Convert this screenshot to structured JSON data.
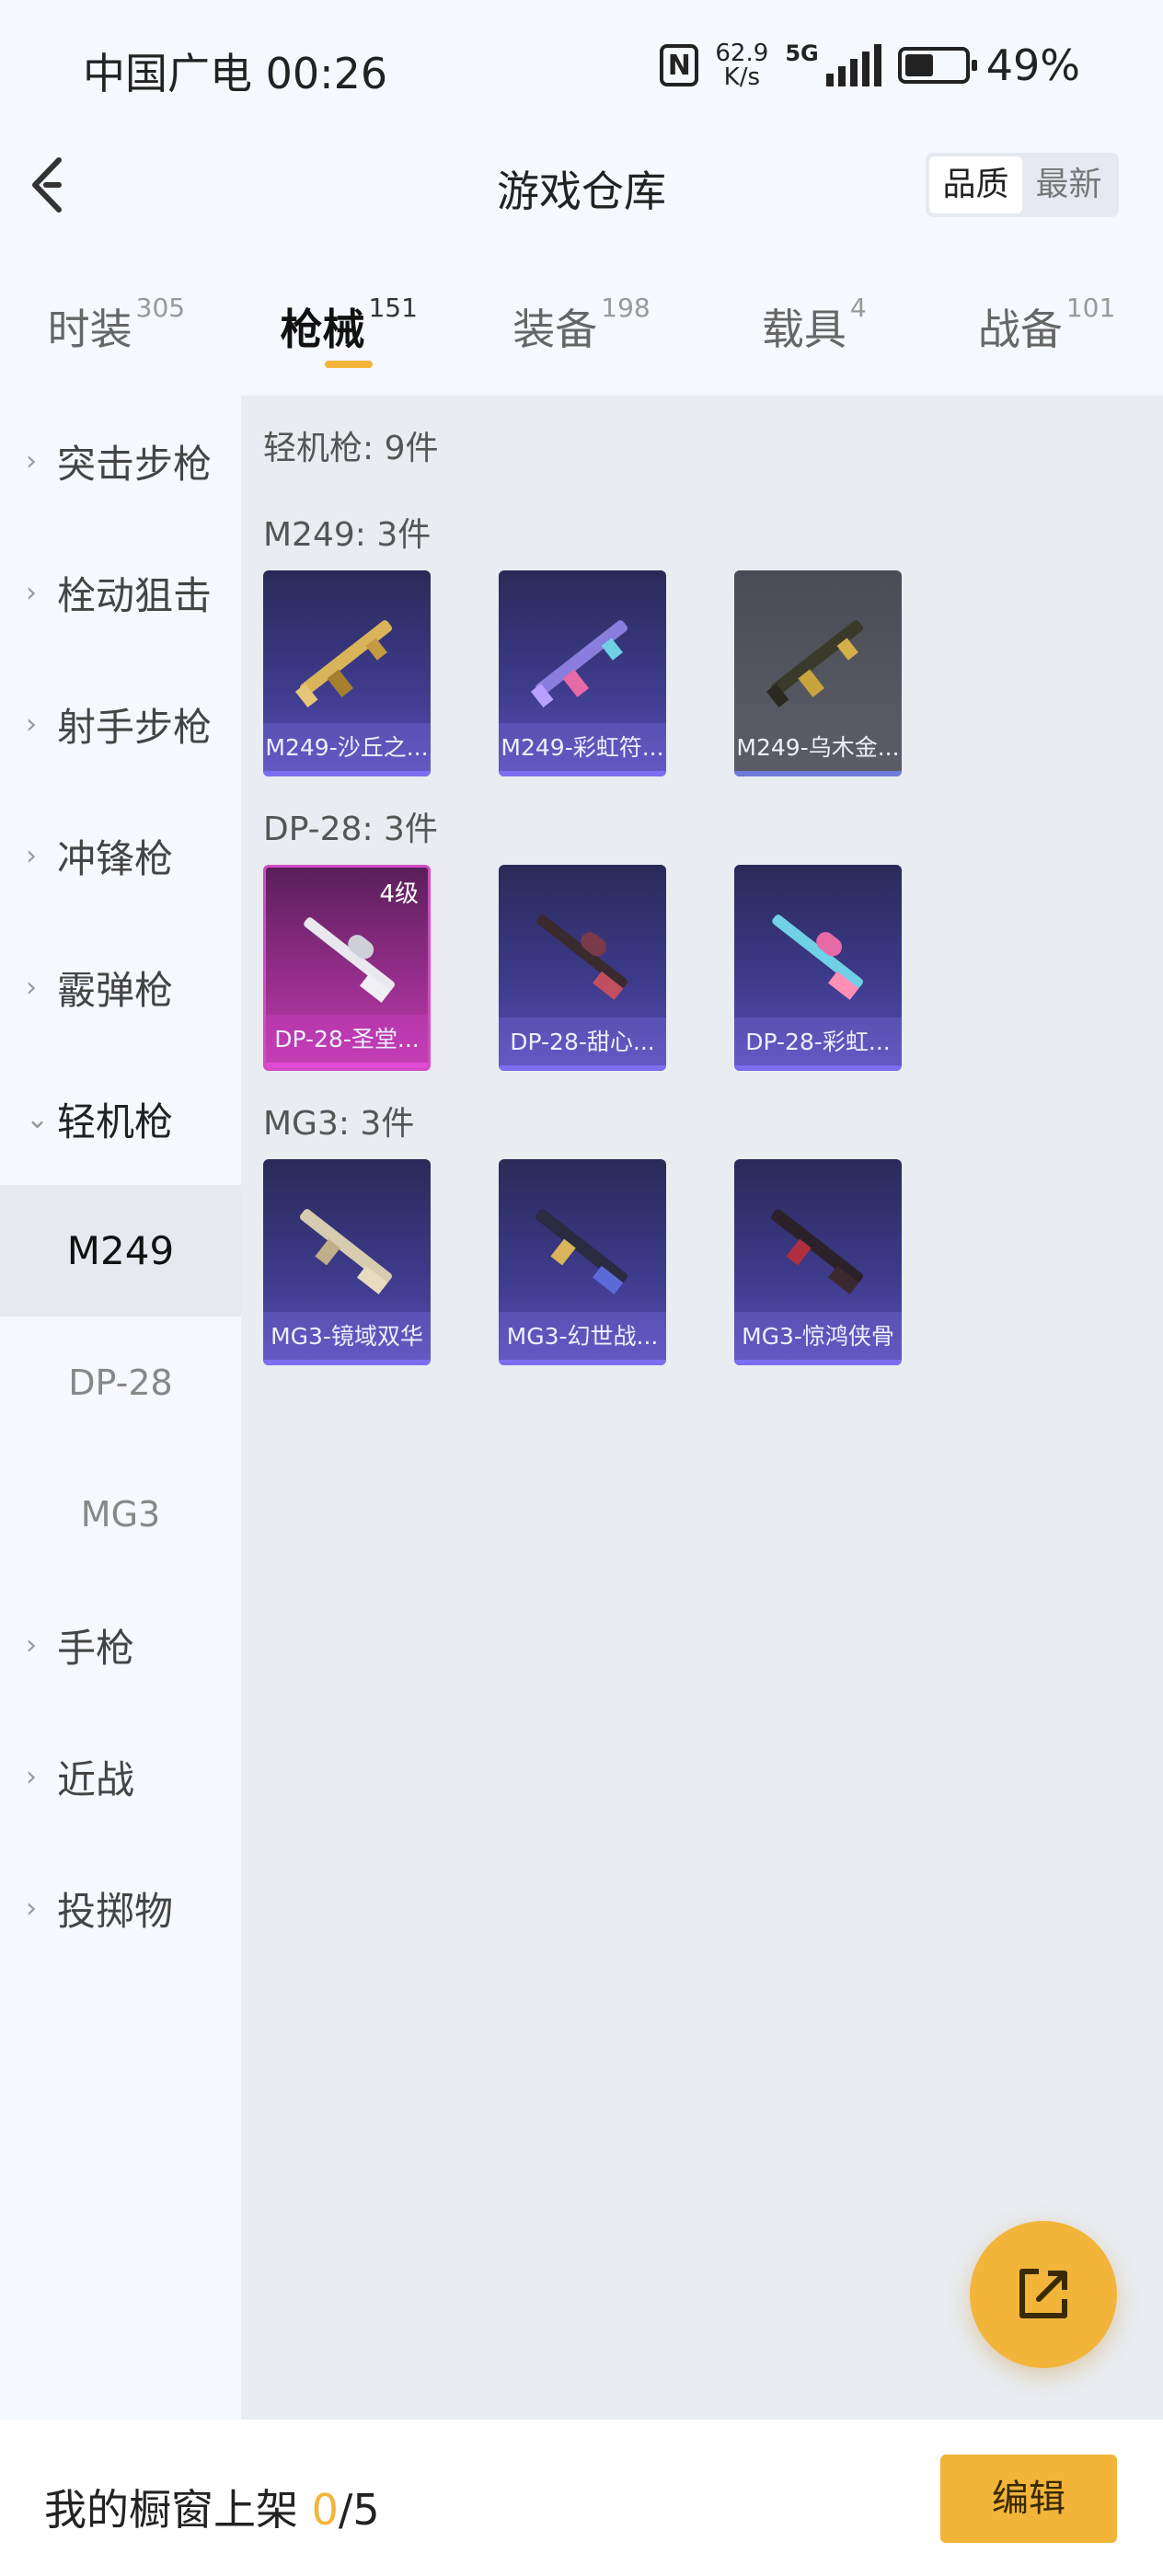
{
  "status_bar": {
    "carrier_time": "中国广电 00:26",
    "net_speed_value": "62.9",
    "net_speed_unit": "K/s",
    "network": "5G",
    "battery": "49%",
    "battery_level": 0.49
  },
  "header": {
    "title": "游戏仓库",
    "sort_options": [
      "品质",
      "最新"
    ],
    "sort_selected": "品质"
  },
  "tabs": [
    {
      "label": "时装",
      "count": "305"
    },
    {
      "label": "枪械",
      "count": "151",
      "active": true
    },
    {
      "label": "装备",
      "count": "198"
    },
    {
      "label": "载具",
      "count": "4"
    },
    {
      "label": "战备",
      "count": "101"
    }
  ],
  "sidebar": {
    "items": [
      {
        "label": "突击步枪"
      },
      {
        "label": "栓动狙击"
      },
      {
        "label": "射手步枪"
      },
      {
        "label": "冲锋枪"
      },
      {
        "label": "霰弹枪"
      },
      {
        "label": "轻机枪",
        "expanded": true
      },
      {
        "label": "手枪"
      },
      {
        "label": "近战"
      },
      {
        "label": "投掷物"
      }
    ],
    "subitems": [
      {
        "label": "M249",
        "active": true
      },
      {
        "label": "DP-28"
      },
      {
        "label": "MG3"
      }
    ]
  },
  "main": {
    "category_summary": "轻机枪: 9件",
    "groups": [
      {
        "title": "M249: 3件",
        "items": [
          {
            "name": "M249-沙丘之...",
            "rarity": "purple"
          },
          {
            "name": "M249-彩虹符...",
            "rarity": "purple"
          },
          {
            "name": "M249-乌木金...",
            "rarity": "gray"
          }
        ]
      },
      {
        "title": "DP-28: 3件",
        "items": [
          {
            "name": "DP-28-圣堂...",
            "rarity": "pink",
            "badge": "4级"
          },
          {
            "name": "DP-28-甜心...",
            "rarity": "purple"
          },
          {
            "name": "DP-28-彩虹...",
            "rarity": "purple"
          }
        ]
      },
      {
        "title": "MG3: 3件",
        "items": [
          {
            "name": "MG3-镜域双华",
            "rarity": "purple"
          },
          {
            "name": "MG3-幻世战...",
            "rarity": "purple"
          },
          {
            "name": "MG3-惊鸿侠骨",
            "rarity": "purple"
          }
        ]
      }
    ]
  },
  "bottom_bar": {
    "label": "我的橱窗上架 ",
    "current": "0",
    "total": "/5",
    "edit_label": "编辑"
  },
  "colors": {
    "accent": "#f2b53a",
    "sidebar_active_bg": "#e6eaef",
    "content_bg": "#e9ecf0"
  }
}
